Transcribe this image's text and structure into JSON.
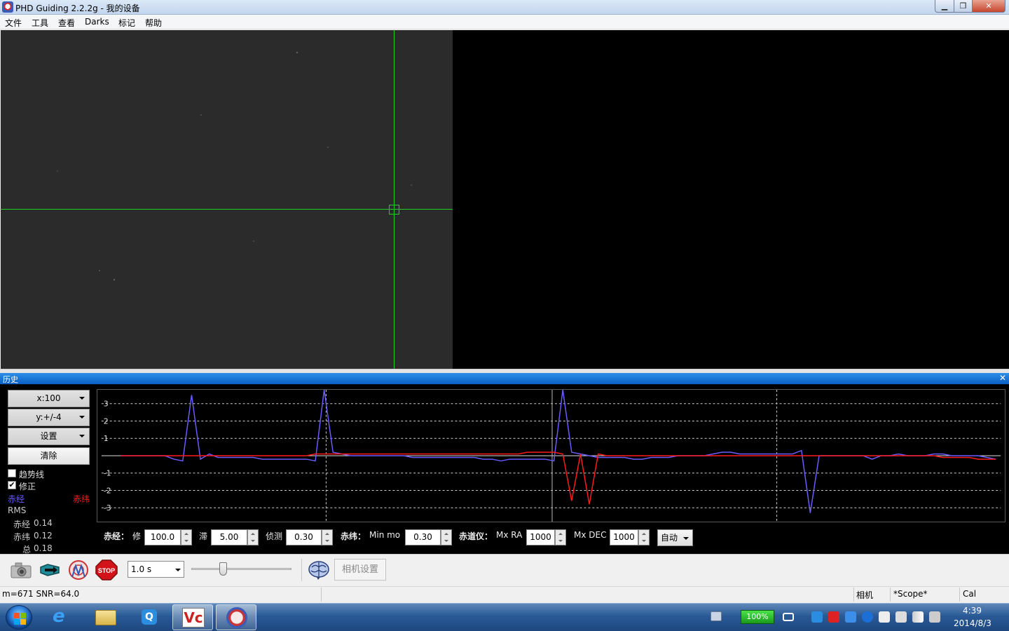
{
  "window": {
    "title": "PHD Guiding 2.2.2g - 我的设备"
  },
  "menu": [
    "文件",
    "工具",
    "查看",
    "Darks",
    "标记",
    "帮助"
  ],
  "history": {
    "title": "历史",
    "x_scale": "x:100",
    "y_scale": "y:+/-4",
    "settings_label": "设置",
    "clear_label": "清除",
    "trend_label": "趋势线",
    "correction_label": "修正",
    "trend_checked": false,
    "correction_checked": true,
    "ra_legend": "赤经",
    "dec_legend": "赤纬",
    "rms_label": "RMS",
    "rms_ra_label": "赤经",
    "rms_ra_value": "0.14",
    "rms_dec_label": "赤纬",
    "rms_dec_value": "0.12",
    "rms_total_label": "总",
    "rms_total_value": "0.18",
    "ra_color": "#6a5cff",
    "dec_color": "#ff1a1a"
  },
  "chart_data": {
    "type": "line",
    "ylim": [
      -4,
      4
    ],
    "y_ticks": [
      "3",
      "2",
      "1",
      "-1",
      "-2",
      "-3"
    ],
    "x_count": 100,
    "series": [
      {
        "name": "赤经",
        "color": "#6a5cff",
        "values": [
          0.0,
          0.0,
          0.0,
          0.0,
          0.0,
          0.0,
          -0.2,
          -0.3,
          3.5,
          -0.2,
          0.1,
          -0.1,
          -0.1,
          -0.1,
          -0.1,
          -0.1,
          -0.2,
          -0.2,
          -0.2,
          -0.2,
          -0.2,
          -0.2,
          -0.3,
          3.8,
          0.2,
          0.1,
          0.0,
          0.0,
          0.0,
          0.0,
          0.0,
          0.0,
          0.0,
          -0.1,
          -0.1,
          -0.1,
          -0.1,
          -0.1,
          -0.1,
          -0.1,
          -0.1,
          -0.2,
          -0.2,
          -0.3,
          -0.2,
          -0.2,
          -0.2,
          -0.2,
          -0.2,
          -0.3,
          3.8,
          0.2,
          0.1,
          0.0,
          -0.1,
          -0.1,
          -0.1,
          -0.1,
          -0.2,
          -0.2,
          -0.1,
          -0.1,
          -0.1,
          0.0,
          0.0,
          0.0,
          0.0,
          0.1,
          0.2,
          0.2,
          0.1,
          0.1,
          0.1,
          0.1,
          0.1,
          0.1,
          0.1,
          0.3,
          -3.3,
          0.0,
          0.0,
          0.0,
          0.0,
          0.0,
          0.0,
          -0.2,
          0.0,
          0.0,
          0.1,
          0.0,
          0.0,
          0.0,
          0.1,
          0.1,
          0.0,
          0.0,
          0.0,
          0.0,
          -0.1,
          -0.2
        ]
      },
      {
        "name": "赤纬",
        "color": "#ff1a1a",
        "values": [
          0.0,
          0.0,
          0.0,
          0.0,
          0.0,
          0.0,
          0.0,
          0.0,
          0.0,
          0.0,
          0.0,
          0.0,
          0.0,
          0.0,
          0.0,
          0.0,
          0.0,
          0.0,
          0.0,
          0.0,
          0.0,
          0.0,
          0.1,
          0.1,
          0.1,
          0.1,
          0.1,
          0.1,
          0.1,
          0.1,
          0.1,
          0.1,
          0.1,
          0.1,
          0.1,
          0.1,
          0.1,
          0.1,
          0.1,
          0.1,
          0.1,
          0.1,
          0.1,
          0.1,
          0.1,
          0.1,
          0.2,
          0.2,
          0.2,
          0.2,
          0.1,
          -2.6,
          0.1,
          -2.8,
          0.1,
          0.0,
          0.0,
          0.0,
          0.0,
          0.0,
          0.0,
          0.0,
          0.0,
          0.0,
          0.0,
          0.0,
          0.0,
          0.0,
          0.0,
          0.0,
          0.0,
          0.0,
          0.0,
          0.0,
          0.0,
          0.0,
          0.0,
          0.0,
          0.0,
          0.0,
          0.0,
          0.0,
          0.0,
          0.0,
          0.0,
          0.0,
          0.0,
          0.0,
          0.0,
          0.0,
          0.0,
          0.0,
          0.0,
          -0.1,
          -0.1,
          -0.1,
          -0.1,
          -0.2,
          -0.2,
          -0.2
        ]
      }
    ]
  },
  "params": {
    "ra_title": "赤经：",
    "ra_agg_label": "修",
    "ra_agg_value": "100.0",
    "ra_hyst_label": "滞",
    "ra_hyst_value": "5.00",
    "min_move_label": "侦测",
    "min_move_value": "0.30",
    "dec_title": "赤纬：",
    "dec_minmo_label": "Min mo",
    "dec_minmo_value": "0.30",
    "mount_title": "赤道仪：",
    "max_ra_label": "Mx RA",
    "max_ra_value": "1000",
    "max_dec_label": "Mx DEC",
    "max_dec_value": "1000",
    "dec_mode": "自动"
  },
  "toolbar": {
    "exposure": "1.0 s",
    "gamma_level": 0.3,
    "camera_settings_label": "相机设置",
    "icons": [
      "camera-icon",
      "telescope-icon",
      "phd-guide-icon",
      "stop-icon",
      "brain-icon"
    ]
  },
  "status": {
    "message": "m=671 SNR=64.0",
    "camera": "相机",
    "scope": "*Scope*",
    "cal": "Cal"
  },
  "taskbar": {
    "battery": "100%",
    "time": "4:39",
    "date": "2014/8/3"
  }
}
